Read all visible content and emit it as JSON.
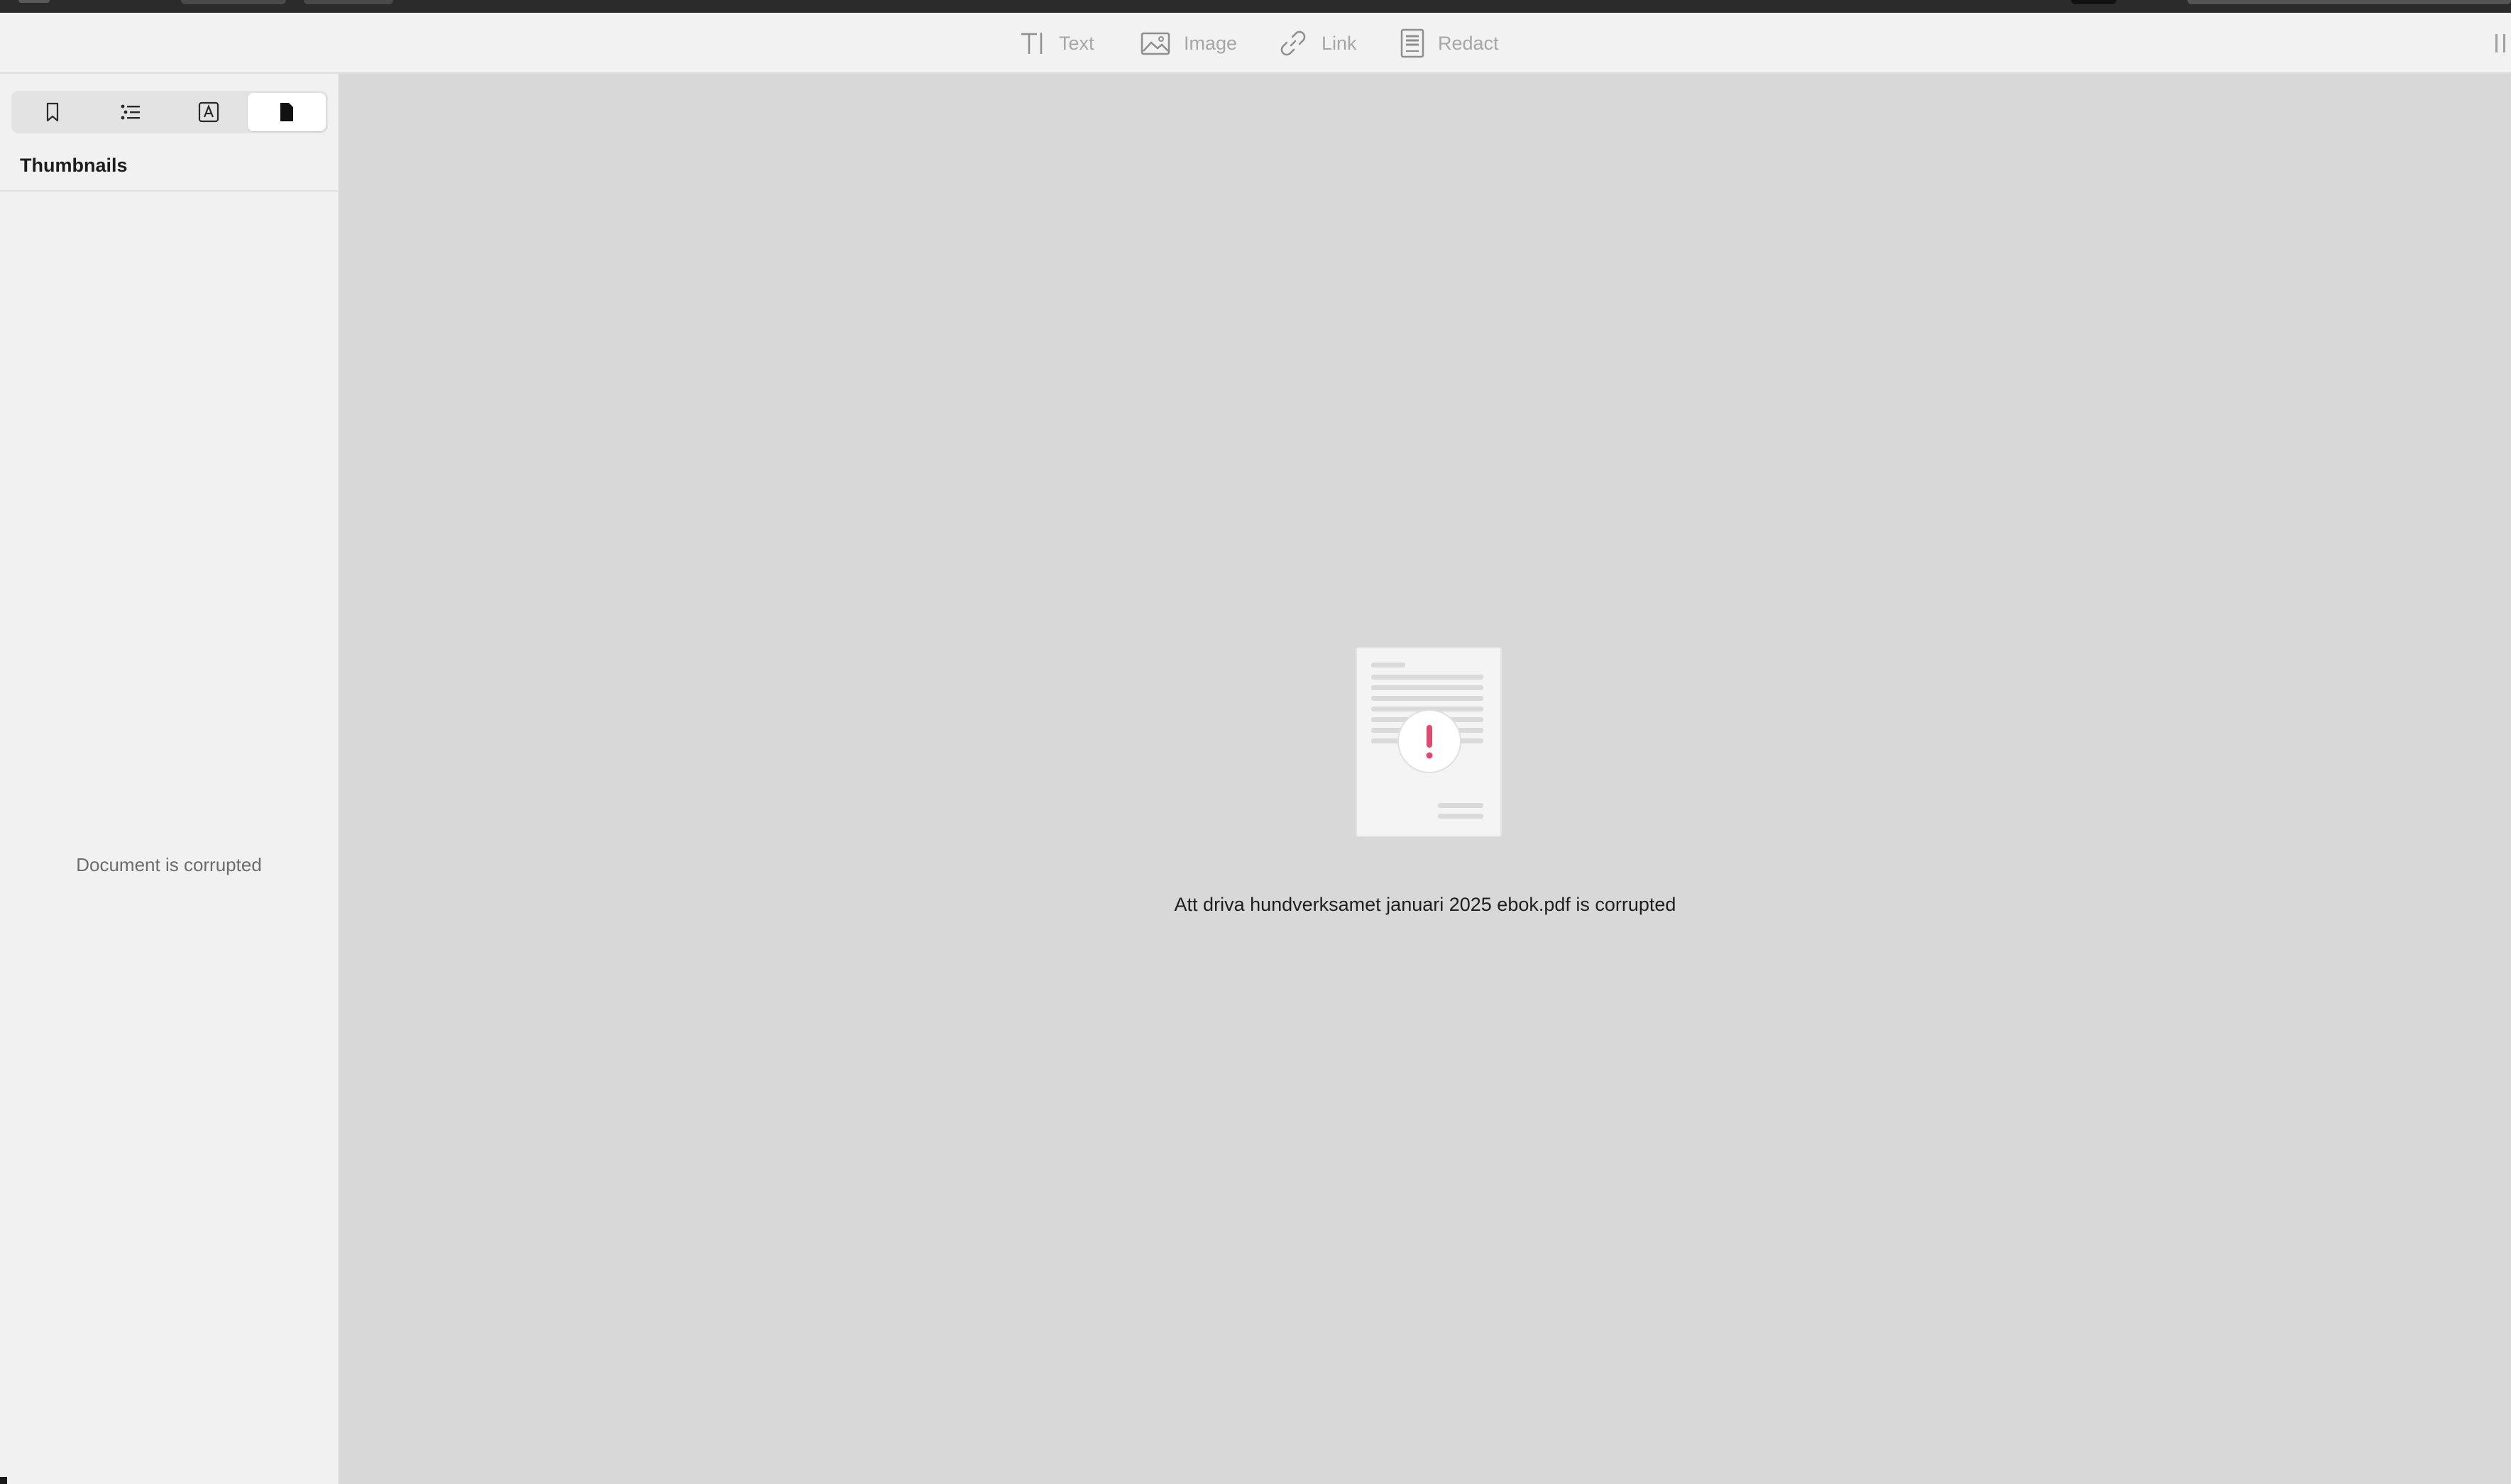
{
  "toolbar": {
    "tools": [
      {
        "label": "Text",
        "icon": "text-cursor-icon"
      },
      {
        "label": "Image",
        "icon": "image-icon"
      },
      {
        "label": "Link",
        "icon": "link-icon"
      },
      {
        "label": "Redact",
        "icon": "redact-icon"
      }
    ]
  },
  "sidebar": {
    "tabs": [
      {
        "icon": "bookmark-icon",
        "active": false
      },
      {
        "icon": "outline-list-icon",
        "active": false
      },
      {
        "icon": "annotations-icon",
        "active": false
      },
      {
        "icon": "thumbnails-page-icon",
        "active": true
      }
    ],
    "title": "Thumbnails",
    "message": "Document is corrupted"
  },
  "main": {
    "error_icon": "corrupted-document-icon",
    "message": "Att driva hundverksamet januari 2025 ebok.pdf is corrupted",
    "accent_color": "#e0486e"
  }
}
